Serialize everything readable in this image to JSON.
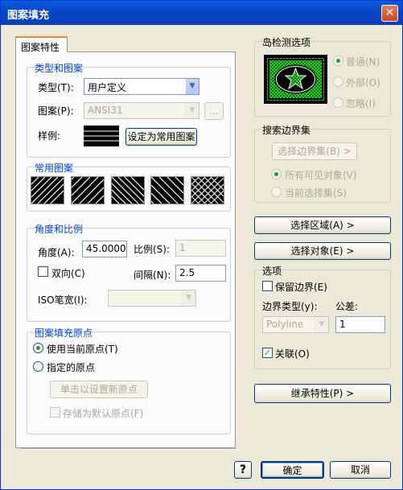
{
  "window": {
    "title": "图案填充",
    "close_glyph": "✕"
  },
  "tab": {
    "label": "图案特性"
  },
  "type_group": {
    "legend": "类型和图案",
    "type_label": "类型(T):",
    "type_value": "用户定义",
    "pattern_label": "图案(P):",
    "pattern_value": "ANSI31",
    "browse_label": "...",
    "sample_label": "样例:",
    "set_common_button": "设定为常用图案"
  },
  "common_group": {
    "legend": "常用图案",
    "patterns": [
      "p1",
      "p2",
      "p3",
      "p4",
      "p5"
    ]
  },
  "angle_group": {
    "legend": "角度和比例",
    "angle_label": "角度(A):",
    "angle_value": "45.000000",
    "scale_label": "比例(S):",
    "scale_value": "1",
    "double_label": "双向(C)",
    "spacing_label": "间隔(N):",
    "spacing_value": "2.5",
    "iso_label": "ISO笔宽(I):",
    "iso_value": ""
  },
  "origin_group": {
    "legend": "图案填充原点",
    "use_current_label": "使用当前原点(T)",
    "specified_label": "指定的原点",
    "click_set_button": "单击以设置新原点",
    "store_default_label": "存储为默认原点(F)"
  },
  "island_group": {
    "legend": "岛检测选项",
    "normal_label": "普通(N)",
    "outer_label": "外部(O)",
    "ignore_label": "忽略(I)"
  },
  "boundary_group": {
    "legend": "搜索边界集",
    "select_set_button": "选择边界集(B) >",
    "all_visible_label": "所有可见对象(V)",
    "current_set_label": "当前选择集(S)"
  },
  "actions": {
    "select_area_button": "选择区域(A) >",
    "select_objects_button": "选择对象(E) >",
    "inherit_button": "继承特性(P) >"
  },
  "options_group": {
    "legend": "选项",
    "retain_label": "保留边界(E)",
    "boundary_type_label": "边界类型(y):",
    "tolerance_label": "公差:",
    "boundary_type_value": "Polyline",
    "tolerance_value": "1",
    "associative_label": "关联(O)"
  },
  "footer": {
    "help_label": "?",
    "ok_button": "确定",
    "cancel_button": "取消"
  },
  "colors": {
    "title_blue": "#0845c7",
    "legend_blue": "#0046d5",
    "face": "#ece9d8"
  }
}
